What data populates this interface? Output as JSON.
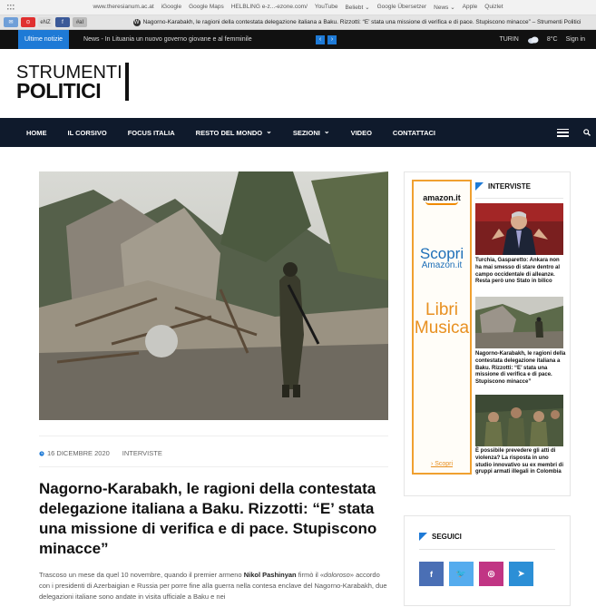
{
  "browser": {
    "bookmarks": [
      "www.theresianum.ac.at",
      "iGoogle",
      "Google Maps",
      "HELBLING e-z...-ezone.com/",
      "YouTube",
      "Beliebt ⌄",
      "Google Übersetzer",
      "News ⌄",
      "Apple",
      "Quizlet"
    ],
    "tab_title": "Nagorno-Karabakh, le ragioni della contestata delegazione italiana a Baku. Rizzotti: “E’ stata una missione di verifica e di pace. Stupiscono minacce” – Strumenti Politici",
    "tab_icons": [
      "✉",
      "⊙",
      "eNZ",
      "f",
      "#aI"
    ]
  },
  "topbar": {
    "ticker_label": "Ultime notizie",
    "ticker_text": "News - In Lituania un nuovo governo giovane e al femminile",
    "city": "TURIN",
    "temperature": "8°C",
    "signin": "Sign in"
  },
  "logo": {
    "line1": "STRUMENTI",
    "line2": "POLITICI"
  },
  "nav": {
    "items": [
      {
        "label": "HOME",
        "dropdown": false
      },
      {
        "label": "IL CORSIVO",
        "dropdown": false
      },
      {
        "label": "FOCUS ITALIA",
        "dropdown": false
      },
      {
        "label": "RESTO DEL MONDO",
        "dropdown": true
      },
      {
        "label": "SEZIONI",
        "dropdown": true
      },
      {
        "label": "VIDEO",
        "dropdown": false
      },
      {
        "label": "CONTATTACI",
        "dropdown": false
      }
    ]
  },
  "article": {
    "date": "16 DICEMBRE 2020",
    "category": "INTERVISTE",
    "title": "Nagorno-Karabakh, le ragioni della contestata delegazione italiana a Baku. Rizzotti: “E’ stata una missione di verifica e di pace. Stupiscono minacce”",
    "body_1": "Trascoso un mese da quel 10 novembre, quando il premier armeno ",
    "body_bold": "Nikol Pashinyan",
    "body_2": " firmò il «",
    "body_italic": "doloroso",
    "body_3": "» accordo con i presidenti di Azerbaigian e Russia per porre fine alla guerra nella contesa enclave del Nagorno-Karabakh, due delegazioni italiane sono andate in visita ufficiale a Baku e nei"
  },
  "ad": {
    "brand": "amazon.it",
    "line1": "Scopri",
    "line2": "Amazon.it",
    "line3": "Libri",
    "line4": "Musica",
    "cta": "› Scopri"
  },
  "sidebar": {
    "heading": "INTERVISTE",
    "items": [
      {
        "caption": "Turchia, Gasparetto: Ankara non ha mai smesso di stare dentro al campo occidentale di alleanze. Resta però uno Stato in bilico"
      },
      {
        "caption": "Nagorno-Karabakh, le ragioni della contestata delegazione italiana a Baku. Rizzotti: “E’ stata una missione di verifica e di pace. Stupiscono minacce”"
      },
      {
        "caption": "È possibile prevedere gli atti di violenza? La risposta in uno studio innovativo su ex membri di gruppi armati illegali in Colombia"
      }
    ]
  },
  "follow": {
    "heading": "SEGUICI",
    "networks": [
      {
        "icon": "facebook-icon",
        "glyph": "f",
        "color": "#4a6fb5"
      },
      {
        "icon": "twitter-icon",
        "glyph": "🐦",
        "color": "#55acee"
      },
      {
        "icon": "instagram-icon",
        "glyph": "◎",
        "color": "#c13584"
      },
      {
        "icon": "telegram-icon",
        "glyph": "➤",
        "color": "#2c8fd6"
      }
    ]
  }
}
